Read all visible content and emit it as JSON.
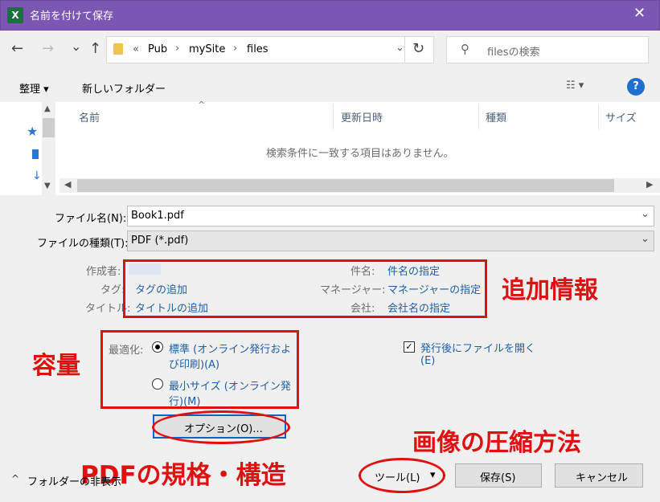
{
  "window": {
    "title": "名前を付けて保存",
    "app_icon": "excel-icon",
    "close": "✕"
  },
  "nav": {
    "back": "←",
    "forward": "→",
    "recent": "⌄",
    "up": "↑",
    "breadcrumb": {
      "prefix": "«",
      "items": [
        "Pub",
        "mySite",
        "files"
      ]
    },
    "search_placeholder": "filesの検索"
  },
  "toolbar": {
    "organize": "整理 ▾",
    "new_folder": "新しいフォルダー"
  },
  "filelist": {
    "columns": [
      "名前",
      "更新日時",
      "種類",
      "サイズ"
    ],
    "empty_message": "検索条件に一致する項目はありません。"
  },
  "form": {
    "filename_label": "ファイル名(N):",
    "filename_value": "Book1.pdf",
    "filetype_label": "ファイルの種類(T):",
    "filetype_value": "PDF (*.pdf)"
  },
  "meta": {
    "author_label": "作成者:",
    "tags_label": "タグ:",
    "tags_link": "タグの追加",
    "title_label": "タイトル:",
    "title_link": "タイトルの追加",
    "subject_label": "件名:",
    "subject_link": "件名の指定",
    "manager_label": "マネージャー:",
    "manager_link": "マネージャーの指定",
    "company_label": "会社:",
    "company_link": "会社名の指定"
  },
  "optimize": {
    "label": "最適化:",
    "standard_line1": "標準 (オンライン発行およ",
    "standard_line2": "び印刷)(A)",
    "minimum_line1": "最小サイズ (オンライン発",
    "minimum_line2": "行)(M)",
    "selected": "standard"
  },
  "open_after": {
    "line1": "発行後にファイルを開く",
    "line2": "(E)",
    "checked": true
  },
  "buttons": {
    "options": "オプション(O)...",
    "tools": "ツール(L)",
    "save": "保存(S)",
    "cancel": "キャンセル"
  },
  "hide_folders": "フォルダーの非表示",
  "annotations": {
    "extra_info": "追加情報",
    "capacity": "容量",
    "compression": "画像の圧縮方法",
    "pdf_standard": "PDFの規格・構造"
  },
  "colors": {
    "titlebar": "#7b56b3",
    "annotation_red": "#e01010",
    "link": "#1e5ea8"
  }
}
